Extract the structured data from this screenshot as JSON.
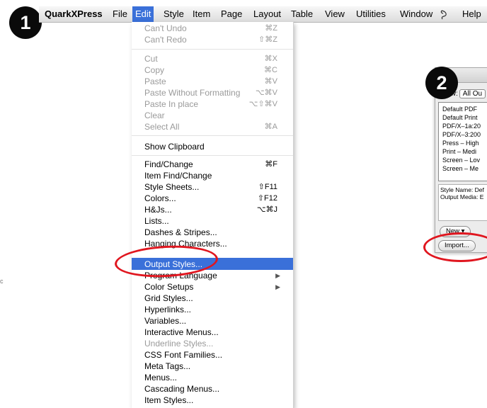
{
  "badges": {
    "step1": "1",
    "step2": "2"
  },
  "menubar": {
    "app": "QuarkXPress",
    "items": [
      "File",
      "Edit",
      "Style",
      "Item",
      "Page",
      "Layout",
      "Table",
      "View",
      "Utilities",
      "Window",
      "Help"
    ],
    "active": "Edit",
    "script_icon": "script-icon"
  },
  "edit_menu": {
    "items": [
      {
        "label": "Can't Undo",
        "shortcut": "⌘Z",
        "disabled": true
      },
      {
        "label": "Can't Redo",
        "shortcut": "⇧⌘Z",
        "disabled": true
      },
      {
        "label": "Cut",
        "shortcut": "⌘X",
        "disabled": true
      },
      {
        "label": "Copy",
        "shortcut": "⌘C",
        "disabled": true
      },
      {
        "label": "Paste",
        "shortcut": "⌘V",
        "disabled": true
      },
      {
        "label": "Paste Without Formatting",
        "shortcut": "⌥⌘V",
        "disabled": true
      },
      {
        "label": "Paste In place",
        "shortcut": "⌥⇧⌘V",
        "disabled": true
      },
      {
        "label": "Clear",
        "shortcut": "",
        "disabled": true
      },
      {
        "label": "Select All",
        "shortcut": "⌘A",
        "disabled": true
      },
      {
        "label": "Show Clipboard",
        "shortcut": "",
        "disabled": false
      },
      {
        "label": "Find/Change",
        "shortcut": "⌘F",
        "disabled": false
      },
      {
        "label": "Item Find/Change",
        "shortcut": "",
        "disabled": false
      },
      {
        "label": "Style Sheets...",
        "shortcut": "⇧F11",
        "disabled": false
      },
      {
        "label": "Colors...",
        "shortcut": "⇧F12",
        "disabled": false
      },
      {
        "label": "H&Js...",
        "shortcut": "⌥⌘J",
        "disabled": false
      },
      {
        "label": "Lists...",
        "shortcut": "",
        "disabled": false
      },
      {
        "label": "Dashes & Stripes...",
        "shortcut": "",
        "disabled": false
      },
      {
        "label": "Hanging Characters...",
        "shortcut": "",
        "disabled": false
      },
      {
        "label": "Output Styles...",
        "shortcut": "",
        "disabled": false,
        "highlighted": true
      },
      {
        "label": "Program Language",
        "shortcut": "",
        "disabled": false,
        "submenu": true
      },
      {
        "label": "Color Setups",
        "shortcut": "",
        "disabled": false,
        "submenu": true
      },
      {
        "label": "Grid Styles...",
        "shortcut": "",
        "disabled": false
      },
      {
        "label": "Hyperlinks...",
        "shortcut": "",
        "disabled": false
      },
      {
        "label": "Variables...",
        "shortcut": "",
        "disabled": false
      },
      {
        "label": "Interactive Menus...",
        "shortcut": "",
        "disabled": false
      },
      {
        "label": "Underline Styles...",
        "shortcut": "",
        "disabled": true
      },
      {
        "label": "CSS Font Families...",
        "shortcut": "",
        "disabled": false
      },
      {
        "label": "Meta Tags...",
        "shortcut": "",
        "disabled": false
      },
      {
        "label": "Menus...",
        "shortcut": "",
        "disabled": false
      },
      {
        "label": "Cascading Menus...",
        "shortcut": "",
        "disabled": false
      },
      {
        "label": "Item Styles...",
        "shortcut": "",
        "disabled": false
      }
    ]
  },
  "dialog": {
    "show_label": "Show:",
    "show_value": "All Ou",
    "list": [
      "Default PDF",
      "Default Print",
      "PDF/X–1a:20",
      "PDF/X–3:200",
      "Press – High",
      "Print – Medi",
      "Screen – Lov",
      "Screen – Me"
    ],
    "info": [
      "Style Name: Def",
      "Output Media: E"
    ],
    "new_button": "New ▾",
    "import_button": "Import..."
  },
  "side_mark": "c"
}
